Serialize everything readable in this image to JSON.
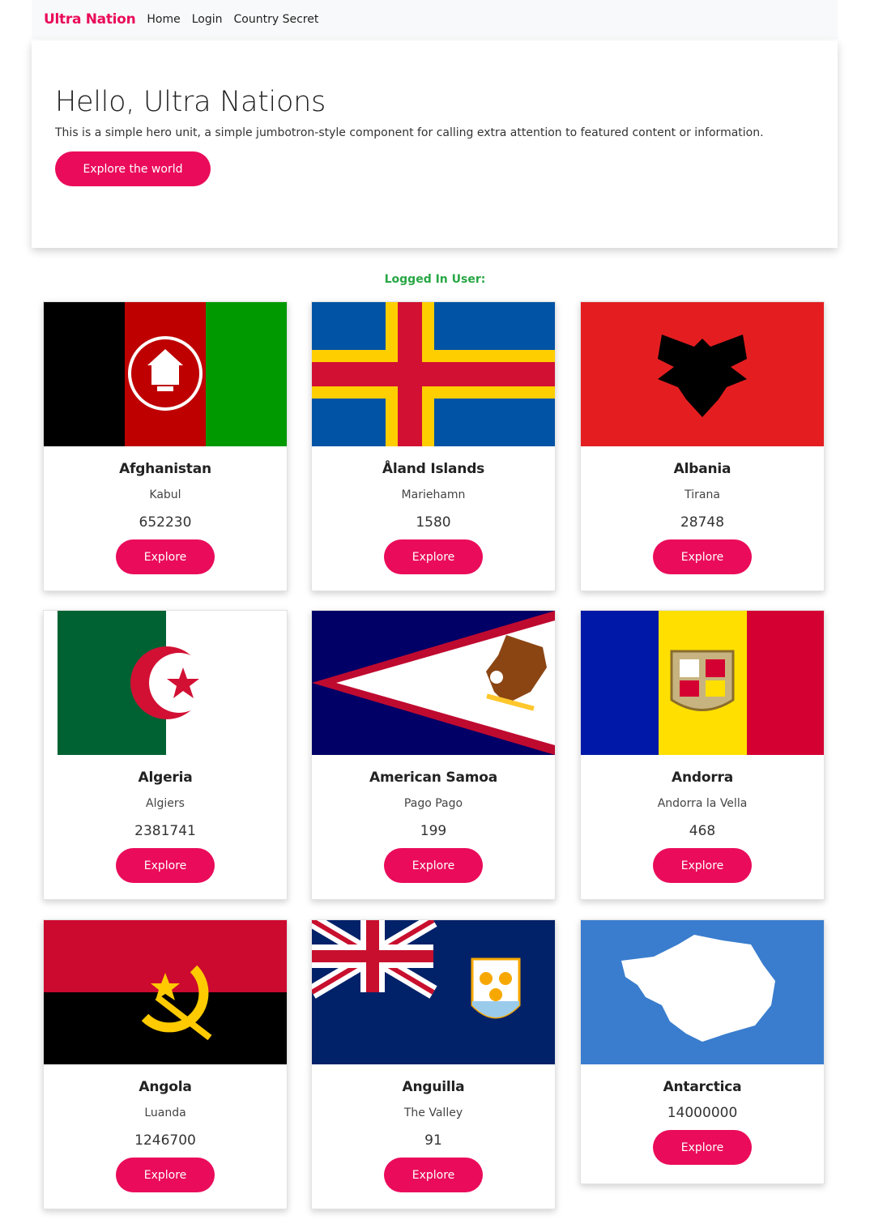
{
  "nav": {
    "brand": "Ultra Nation",
    "links": [
      "Home",
      "Login",
      "Country Secret"
    ]
  },
  "hero": {
    "title": "Hello, Ultra Nations",
    "text": "This is a simple hero unit, a simple jumbotron-style component for calling extra attention to featured content or information.",
    "button": "Explore the world"
  },
  "logged_in_label": "Logged In User:",
  "countries": [
    {
      "name": "Afghanistan",
      "capital": "Kabul",
      "area": "652230",
      "button": "Explore"
    },
    {
      "name": "Åland Islands",
      "capital": "Mariehamn",
      "area": "1580",
      "button": "Explore"
    },
    {
      "name": "Albania",
      "capital": "Tirana",
      "area": "28748",
      "button": "Explore"
    },
    {
      "name": "Algeria",
      "capital": "Algiers",
      "area": "2381741",
      "button": "Explore"
    },
    {
      "name": "American Samoa",
      "capital": "Pago Pago",
      "area": "199",
      "button": "Explore"
    },
    {
      "name": "Andorra",
      "capital": "Andorra la Vella",
      "area": "468",
      "button": "Explore"
    },
    {
      "name": "Angola",
      "capital": "Luanda",
      "area": "1246700",
      "button": "Explore"
    },
    {
      "name": "Anguilla",
      "capital": "The Valley",
      "area": "91",
      "button": "Explore"
    },
    {
      "name": "Antarctica",
      "area": "14000000",
      "button": "Explore"
    }
  ],
  "colors": {
    "accent": "#ea0b5a",
    "logged": "#28a745",
    "nav_bg": "#f8f9fa"
  }
}
